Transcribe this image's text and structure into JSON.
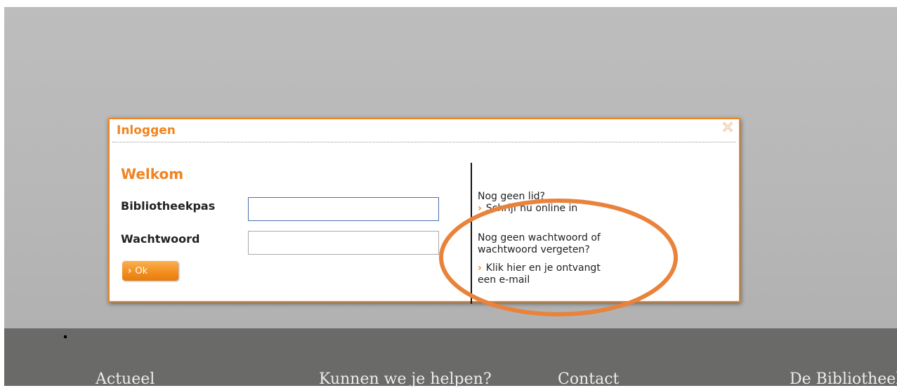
{
  "dialog": {
    "title": "Inloggen",
    "welcome": "Welkom",
    "fields": {
      "card_label": "Bibliotheekpas",
      "card_value": "",
      "password_label": "Wachtwoord",
      "password_value": ""
    },
    "ok_label": "Ok",
    "side": {
      "no_member": "Nog geen lid?",
      "signup_link": "Schrijf nu online in",
      "no_password": "Nog geen wachtwoord of wachtwoord vergeten?",
      "email_link": "Klik hier en je ontvangt",
      "email_link_cont": "een e-mail"
    }
  },
  "footer": {
    "links": [
      "Actueel",
      "Kunnen we je helpen?",
      "Contact",
      "De Bibliotheek"
    ]
  },
  "icons": {
    "close": "close-icon",
    "chevron": "chevron-right-icon"
  },
  "colors": {
    "accent": "#f0841f",
    "overlay": "#b8b8b8",
    "footer": "#6a6a69",
    "annotation": "#e9823a"
  }
}
